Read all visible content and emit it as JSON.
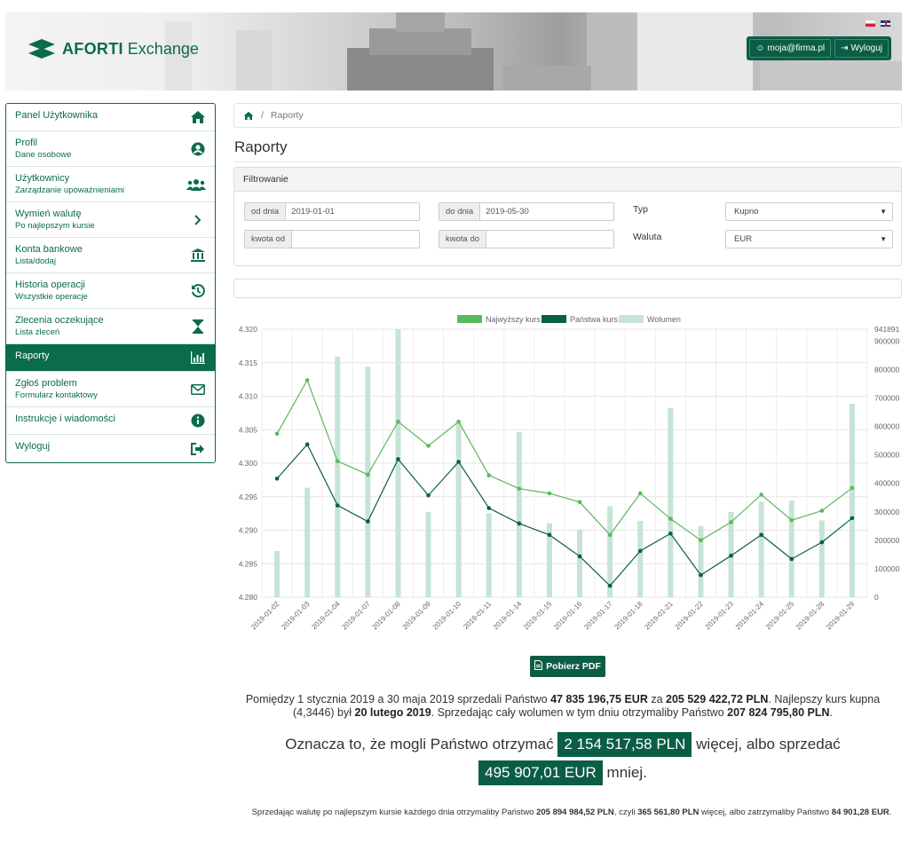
{
  "brand": {
    "name_bold": "AFORTI",
    "name_light": "Exchange"
  },
  "header": {
    "email": "moja@firma.pl",
    "logout": "Wyloguj"
  },
  "sidebar": {
    "items": [
      {
        "title": "Panel Użytkownika",
        "sub": "",
        "icon": "home-icon"
      },
      {
        "title": "Profil",
        "sub": "Dane osobowe",
        "icon": "user-circle-icon"
      },
      {
        "title": "Użytkownicy",
        "sub": "Zarządzanie upoważnieniami",
        "icon": "users-icon"
      },
      {
        "title": "Wymień walutę",
        "sub": "Po najlepszym kursie",
        "icon": "chevron-right-icon"
      },
      {
        "title": "Konta bankowe",
        "sub": "Lista/dodaj",
        "icon": "bank-icon"
      },
      {
        "title": "Historia operacji",
        "sub": "Wszystkie operacje",
        "icon": "history-icon"
      },
      {
        "title": "Zlecenia oczekujące",
        "sub": "Lista zleceń",
        "icon": "hourglass-icon"
      },
      {
        "title": "Raporty",
        "sub": "",
        "icon": "chart-icon"
      },
      {
        "title": "Zgłoś problem",
        "sub": "Formularz kontaktowy",
        "icon": "envelope-icon"
      },
      {
        "title": "Instrukcje i wiadomości",
        "sub": "",
        "icon": "info-icon"
      },
      {
        "title": "Wyloguj",
        "sub": "",
        "icon": "sign-out-icon"
      }
    ]
  },
  "breadcrumb": {
    "current": "Raporty"
  },
  "page": {
    "title": "Raporty"
  },
  "filter": {
    "header": "Filtrowanie",
    "from_label": "od dnia",
    "from_value": "2019-01-01",
    "to_label": "do dnia",
    "to_value": "2019-05-30",
    "amount_from_label": "kwota od",
    "amount_from_value": "",
    "amount_to_label": "kwota do",
    "amount_to_value": "",
    "type_label": "Typ",
    "type_value": "Kupno",
    "currency_label": "Waluta",
    "currency_value": "EUR"
  },
  "colors": {
    "accent": "#0b6b4d",
    "dark": "#0b5e45",
    "light_line": "#5cb85c",
    "dark_line": "#0b5e45",
    "volume": "#c6e4d6"
  },
  "chart_data": {
    "type": "line",
    "categories": [
      "2019-01-02",
      "2019-01-03",
      "2019-01-04",
      "2019-01-07",
      "2019-01-08",
      "2019-01-09",
      "2019-01-10",
      "2019-01-11",
      "2019-01-14",
      "2019-01-15",
      "2019-01-16",
      "2019-01-17",
      "2019-01-18",
      "2019-01-21",
      "2019-01-22",
      "2019-01-23",
      "2019-01-24",
      "2019-01-25",
      "2019-01-28",
      "2019-01-29"
    ],
    "series": [
      {
        "name": "Najwyższy kurs",
        "axis": "left",
        "kind": "line",
        "values": [
          4.3044,
          4.3124,
          4.3003,
          4.2983,
          4.3062,
          4.3026,
          4.3062,
          4.2982,
          4.2962,
          4.2955,
          4.2942,
          4.2893,
          4.2955,
          4.2917,
          4.2885,
          4.2912,
          4.2953,
          4.2915,
          4.2929,
          4.2963
        ]
      },
      {
        "name": "Państwa kurs",
        "axis": "left",
        "kind": "line",
        "values": [
          4.2977,
          4.3028,
          4.2937,
          4.2913,
          4.3006,
          4.2952,
          4.3002,
          4.2933,
          4.291,
          4.2893,
          4.2861,
          4.2817,
          4.2869,
          4.2895,
          4.2833,
          4.2862,
          4.2893,
          4.2857,
          4.2882,
          4.2918
        ]
      },
      {
        "name": "Wolumen",
        "axis": "right",
        "kind": "bar",
        "values": [
          162000,
          385000,
          845000,
          810000,
          941891,
          300000,
          610000,
          295000,
          580000,
          260000,
          238000,
          320000,
          268000,
          665000,
          250000,
          300000,
          335000,
          340000,
          270000,
          680000
        ]
      }
    ],
    "y_left": {
      "min": 4.28,
      "max": 4.32,
      "ticks": [
        "4.280",
        "4.285",
        "4.290",
        "4.295",
        "4.300",
        "4.305",
        "4.310",
        "4.315",
        "4.320"
      ]
    },
    "y_right": {
      "min": 0,
      "max": 941891,
      "ticks": [
        "0",
        "100000",
        "200000",
        "300000",
        "400000",
        "500000",
        "600000",
        "700000",
        "800000",
        "900000"
      ],
      "max_label": "941891"
    },
    "legend_position": "top-center",
    "grid": true
  },
  "actions": {
    "pdf": "Pobierz PDF"
  },
  "summary": {
    "p1_a": "Pomiędzy 1 stycznia 2019 a 30 maja 2019 sprzedali Państwo ",
    "p1_eur": "47 835 196,75 EUR",
    "p1_b": " za ",
    "p1_pln": "205 529 422,72 PLN",
    "p1_c": ". Najlepszy kurs kupna (4,3446) był ",
    "p1_date": "20 lutego 2019",
    "p1_d": ". Sprzedając cały wolumen w tym dniu otrzymaliby Państwo ",
    "p1_total": "207 824 795,80 PLN",
    "p1_e": ".",
    "big_a": "Oznacza to, że mogli Państwo otrzymać ",
    "big_pln": "2 154 517,58 PLN",
    "big_b": " więcej, albo sprzedać ",
    "big_eur": "495 907,01 EUR",
    "big_c": " mniej.",
    "p2_a": "Sprzedając walutę po najlepszym kursie każdego dnia otrzymaliby Państwo ",
    "p2_pln": "205 894 984,52 PLN",
    "p2_b": ", czyli ",
    "p2_more": "365 561,80 PLN",
    "p2_c": " więcej, albo zatrzymaliby Państwo ",
    "p2_eur": "84 901,28 EUR",
    "p2_d": "."
  }
}
